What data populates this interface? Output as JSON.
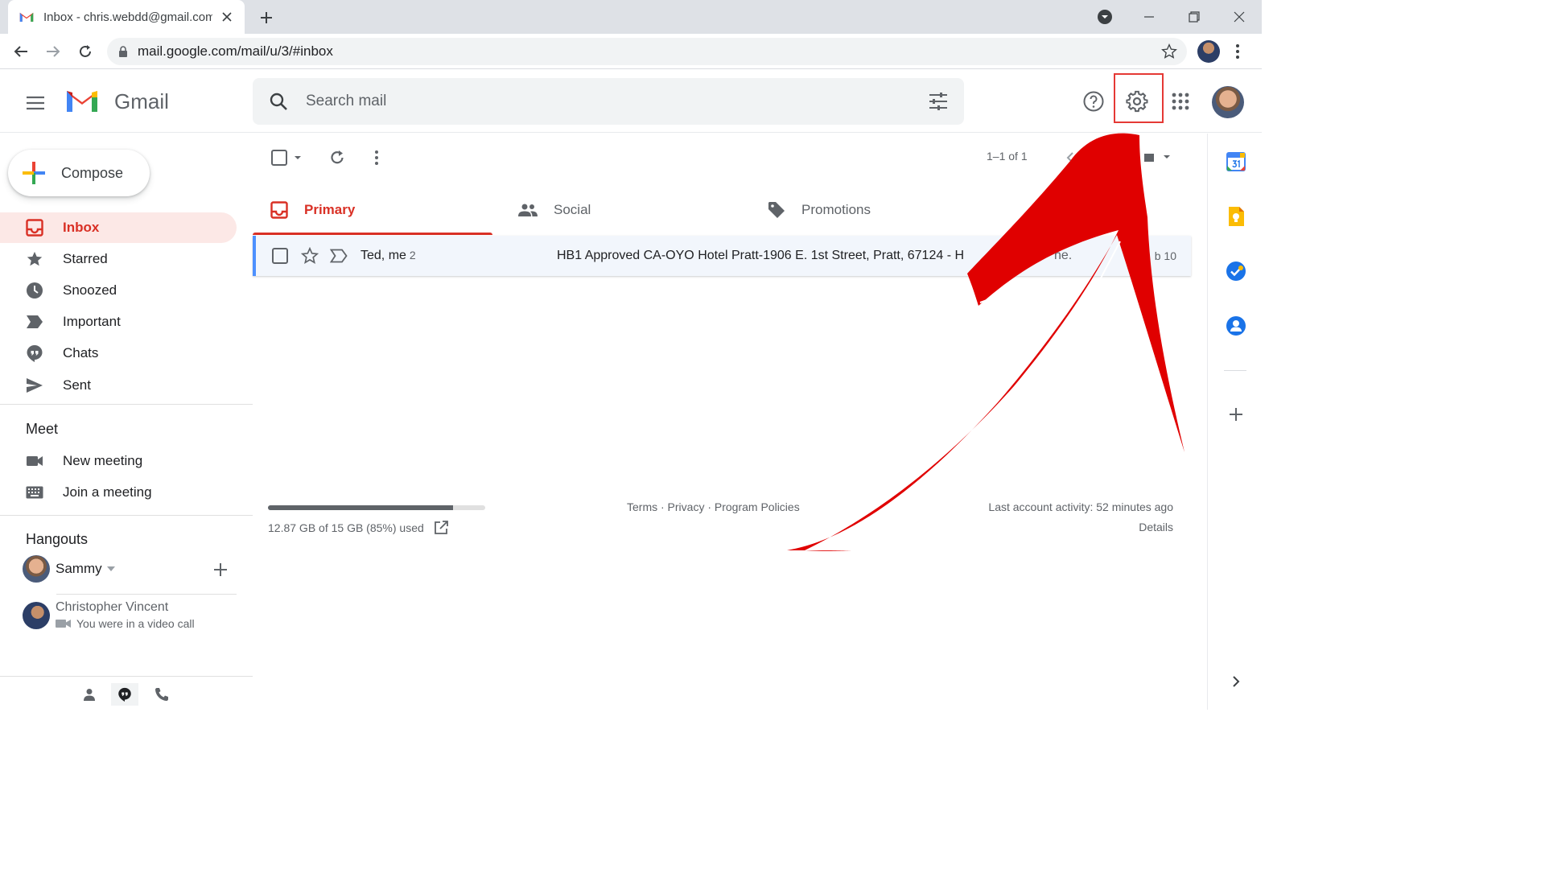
{
  "browser": {
    "tab_title": "Inbox - chris.webdd@gmail.com",
    "url": "mail.google.com/mail/u/3/#inbox"
  },
  "gmail": {
    "logo_text": "Gmail",
    "search_placeholder": "Search mail"
  },
  "sidebar": {
    "compose_label": "Compose",
    "items": [
      {
        "label": "Inbox",
        "icon": "inbox-icon",
        "active": true
      },
      {
        "label": "Starred",
        "icon": "star-icon"
      },
      {
        "label": "Snoozed",
        "icon": "clock-icon"
      },
      {
        "label": "Important",
        "icon": "important-icon"
      },
      {
        "label": "Chats",
        "icon": "chat-icon"
      },
      {
        "label": "Sent",
        "icon": "send-icon"
      }
    ],
    "meet": {
      "title": "Meet",
      "items": [
        {
          "label": "New meeting",
          "icon": "video-icon"
        },
        {
          "label": "Join a meeting",
          "icon": "keyboard-icon"
        }
      ]
    },
    "hangouts": {
      "title": "Hangouts",
      "user": "Sammy",
      "contact_name": "Christopher Vincent",
      "contact_status": "You were in a video call"
    }
  },
  "toolbar": {
    "pager": "1–1 of 1"
  },
  "tabs": [
    {
      "label": "Primary",
      "icon": "inbox-icon",
      "active": true
    },
    {
      "label": "Social",
      "icon": "people-icon"
    },
    {
      "label": "Promotions",
      "icon": "tag-icon"
    }
  ],
  "mail": {
    "sender": "Ted, me",
    "count": "2",
    "subject": "HB1 Approved CA-OYO Hotel Pratt-1906 E. 1st Street, Pratt, 67124 - H",
    "subject_tail": "ne.",
    "date": "b 10"
  },
  "footer": {
    "storage_text": "12.87 GB of 15 GB (85%) used",
    "storage_fraction": 0.85,
    "links": "Terms · Privacy · Program Policies",
    "activity": "Last account activity: 52 minutes ago",
    "details": "Details"
  },
  "colors": {
    "accent_red": "#d93025",
    "annotation_red": "#e00000"
  }
}
